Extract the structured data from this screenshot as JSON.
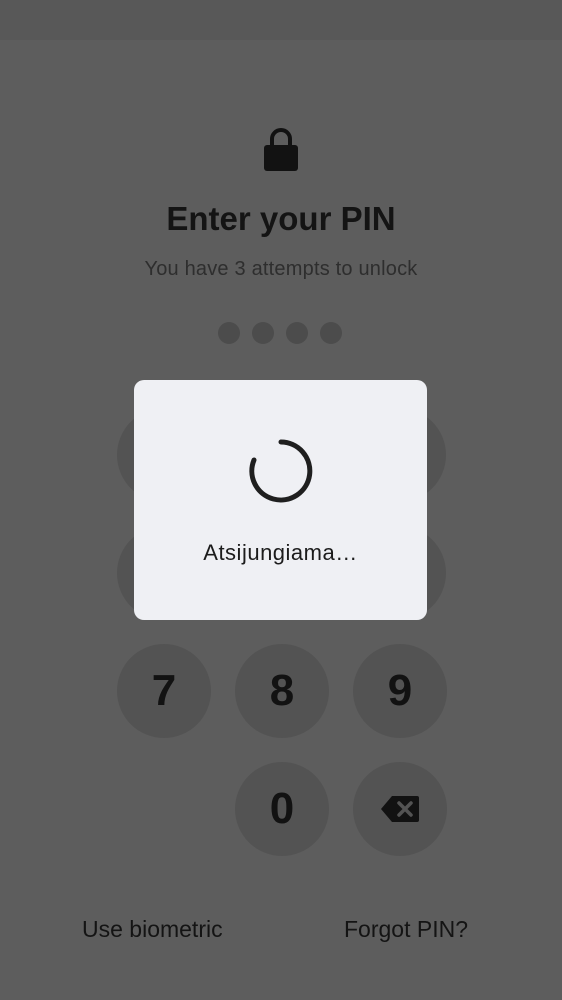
{
  "lock_screen": {
    "icon": "lock-icon",
    "title": "Enter your PIN",
    "subtitle": "You have 3 attempts to unlock",
    "pin_length": 4,
    "pin_entered": 0
  },
  "keypad": {
    "keys": [
      "7",
      "8",
      "9",
      "0"
    ],
    "backspace_icon": "backspace-icon"
  },
  "footer": {
    "biometric_label": "Use biometric",
    "forgot_label": "Forgot PIN?"
  },
  "dialog": {
    "spinner_icon": "spinner-icon",
    "message": "Atsijungiama…"
  },
  "colors": {
    "scrim": "#5d5d5d",
    "dialog_bg": "#eff0f4",
    "spinner": "#1f1f1f"
  }
}
